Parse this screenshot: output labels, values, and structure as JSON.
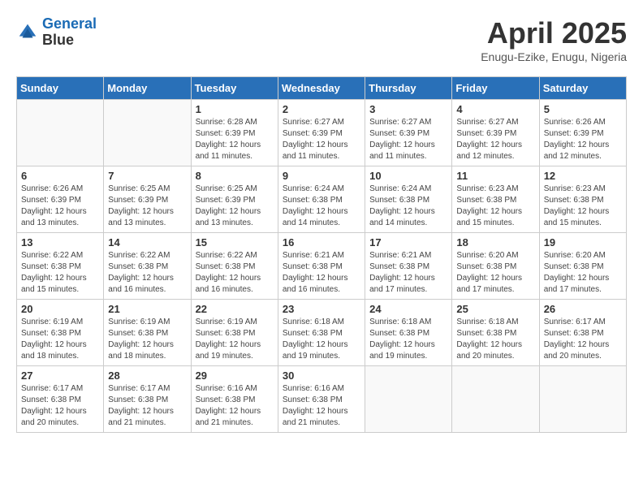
{
  "header": {
    "logo_line1": "General",
    "logo_line2": "Blue",
    "month": "April 2025",
    "location": "Enugu-Ezike, Enugu, Nigeria"
  },
  "weekdays": [
    "Sunday",
    "Monday",
    "Tuesday",
    "Wednesday",
    "Thursday",
    "Friday",
    "Saturday"
  ],
  "weeks": [
    [
      {
        "day": "",
        "sunrise": "",
        "sunset": "",
        "daylight": ""
      },
      {
        "day": "",
        "sunrise": "",
        "sunset": "",
        "daylight": ""
      },
      {
        "day": "1",
        "sunrise": "Sunrise: 6:28 AM",
        "sunset": "Sunset: 6:39 PM",
        "daylight": "Daylight: 12 hours and 11 minutes."
      },
      {
        "day": "2",
        "sunrise": "Sunrise: 6:27 AM",
        "sunset": "Sunset: 6:39 PM",
        "daylight": "Daylight: 12 hours and 11 minutes."
      },
      {
        "day": "3",
        "sunrise": "Sunrise: 6:27 AM",
        "sunset": "Sunset: 6:39 PM",
        "daylight": "Daylight: 12 hours and 11 minutes."
      },
      {
        "day": "4",
        "sunrise": "Sunrise: 6:27 AM",
        "sunset": "Sunset: 6:39 PM",
        "daylight": "Daylight: 12 hours and 12 minutes."
      },
      {
        "day": "5",
        "sunrise": "Sunrise: 6:26 AM",
        "sunset": "Sunset: 6:39 PM",
        "daylight": "Daylight: 12 hours and 12 minutes."
      }
    ],
    [
      {
        "day": "6",
        "sunrise": "Sunrise: 6:26 AM",
        "sunset": "Sunset: 6:39 PM",
        "daylight": "Daylight: 12 hours and 13 minutes."
      },
      {
        "day": "7",
        "sunrise": "Sunrise: 6:25 AM",
        "sunset": "Sunset: 6:39 PM",
        "daylight": "Daylight: 12 hours and 13 minutes."
      },
      {
        "day": "8",
        "sunrise": "Sunrise: 6:25 AM",
        "sunset": "Sunset: 6:39 PM",
        "daylight": "Daylight: 12 hours and 13 minutes."
      },
      {
        "day": "9",
        "sunrise": "Sunrise: 6:24 AM",
        "sunset": "Sunset: 6:38 PM",
        "daylight": "Daylight: 12 hours and 14 minutes."
      },
      {
        "day": "10",
        "sunrise": "Sunrise: 6:24 AM",
        "sunset": "Sunset: 6:38 PM",
        "daylight": "Daylight: 12 hours and 14 minutes."
      },
      {
        "day": "11",
        "sunrise": "Sunrise: 6:23 AM",
        "sunset": "Sunset: 6:38 PM",
        "daylight": "Daylight: 12 hours and 15 minutes."
      },
      {
        "day": "12",
        "sunrise": "Sunrise: 6:23 AM",
        "sunset": "Sunset: 6:38 PM",
        "daylight": "Daylight: 12 hours and 15 minutes."
      }
    ],
    [
      {
        "day": "13",
        "sunrise": "Sunrise: 6:22 AM",
        "sunset": "Sunset: 6:38 PM",
        "daylight": "Daylight: 12 hours and 15 minutes."
      },
      {
        "day": "14",
        "sunrise": "Sunrise: 6:22 AM",
        "sunset": "Sunset: 6:38 PM",
        "daylight": "Daylight: 12 hours and 16 minutes."
      },
      {
        "day": "15",
        "sunrise": "Sunrise: 6:22 AM",
        "sunset": "Sunset: 6:38 PM",
        "daylight": "Daylight: 12 hours and 16 minutes."
      },
      {
        "day": "16",
        "sunrise": "Sunrise: 6:21 AM",
        "sunset": "Sunset: 6:38 PM",
        "daylight": "Daylight: 12 hours and 16 minutes."
      },
      {
        "day": "17",
        "sunrise": "Sunrise: 6:21 AM",
        "sunset": "Sunset: 6:38 PM",
        "daylight": "Daylight: 12 hours and 17 minutes."
      },
      {
        "day": "18",
        "sunrise": "Sunrise: 6:20 AM",
        "sunset": "Sunset: 6:38 PM",
        "daylight": "Daylight: 12 hours and 17 minutes."
      },
      {
        "day": "19",
        "sunrise": "Sunrise: 6:20 AM",
        "sunset": "Sunset: 6:38 PM",
        "daylight": "Daylight: 12 hours and 17 minutes."
      }
    ],
    [
      {
        "day": "20",
        "sunrise": "Sunrise: 6:19 AM",
        "sunset": "Sunset: 6:38 PM",
        "daylight": "Daylight: 12 hours and 18 minutes."
      },
      {
        "day": "21",
        "sunrise": "Sunrise: 6:19 AM",
        "sunset": "Sunset: 6:38 PM",
        "daylight": "Daylight: 12 hours and 18 minutes."
      },
      {
        "day": "22",
        "sunrise": "Sunrise: 6:19 AM",
        "sunset": "Sunset: 6:38 PM",
        "daylight": "Daylight: 12 hours and 19 minutes."
      },
      {
        "day": "23",
        "sunrise": "Sunrise: 6:18 AM",
        "sunset": "Sunset: 6:38 PM",
        "daylight": "Daylight: 12 hours and 19 minutes."
      },
      {
        "day": "24",
        "sunrise": "Sunrise: 6:18 AM",
        "sunset": "Sunset: 6:38 PM",
        "daylight": "Daylight: 12 hours and 19 minutes."
      },
      {
        "day": "25",
        "sunrise": "Sunrise: 6:18 AM",
        "sunset": "Sunset: 6:38 PM",
        "daylight": "Daylight: 12 hours and 20 minutes."
      },
      {
        "day": "26",
        "sunrise": "Sunrise: 6:17 AM",
        "sunset": "Sunset: 6:38 PM",
        "daylight": "Daylight: 12 hours and 20 minutes."
      }
    ],
    [
      {
        "day": "27",
        "sunrise": "Sunrise: 6:17 AM",
        "sunset": "Sunset: 6:38 PM",
        "daylight": "Daylight: 12 hours and 20 minutes."
      },
      {
        "day": "28",
        "sunrise": "Sunrise: 6:17 AM",
        "sunset": "Sunset: 6:38 PM",
        "daylight": "Daylight: 12 hours and 21 minutes."
      },
      {
        "day": "29",
        "sunrise": "Sunrise: 6:16 AM",
        "sunset": "Sunset: 6:38 PM",
        "daylight": "Daylight: 12 hours and 21 minutes."
      },
      {
        "day": "30",
        "sunrise": "Sunrise: 6:16 AM",
        "sunset": "Sunset: 6:38 PM",
        "daylight": "Daylight: 12 hours and 21 minutes."
      },
      {
        "day": "",
        "sunrise": "",
        "sunset": "",
        "daylight": ""
      },
      {
        "day": "",
        "sunrise": "",
        "sunset": "",
        "daylight": ""
      },
      {
        "day": "",
        "sunrise": "",
        "sunset": "",
        "daylight": ""
      }
    ]
  ]
}
